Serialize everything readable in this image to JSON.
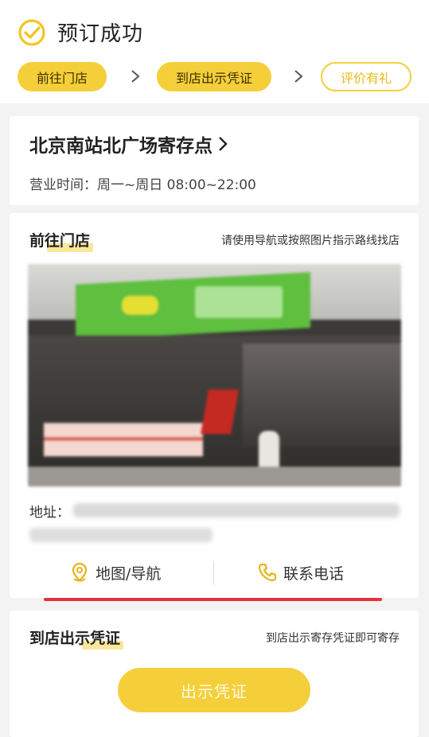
{
  "header": {
    "title": "预订成功",
    "icon": "check-circle-icon"
  },
  "steps": [
    {
      "label": "前往门店",
      "state": "active"
    },
    {
      "label": "到店出示凭证",
      "state": "active"
    },
    {
      "label": "评价有礼",
      "state": "outline"
    }
  ],
  "store": {
    "name": "北京南站北广场寄存点",
    "hours": "营业时间：周一~周日 08:00~22:00"
  },
  "navigate": {
    "title": "前往门店",
    "hint": "请使用导航或按照图片指示路线找店",
    "address_label": "地址：",
    "map_button": "地图/导航",
    "phone_button": "联系电话"
  },
  "voucher": {
    "title": "到店出示凭证",
    "hint": "到店出示寄存凭证即可寄存",
    "button": "出示凭证"
  },
  "colors": {
    "accent": "#f5cf3a",
    "highlight": "#fbe79a",
    "alert_line": "#e0343c"
  }
}
